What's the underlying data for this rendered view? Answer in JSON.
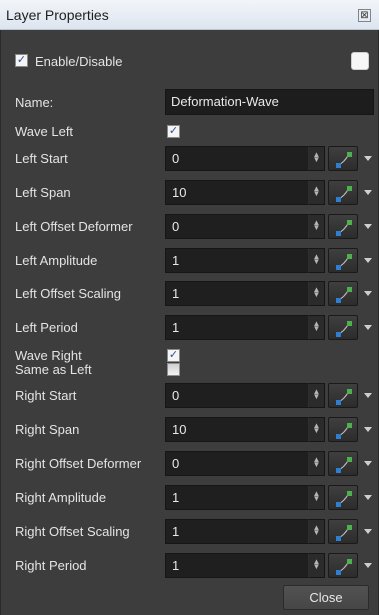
{
  "window": {
    "title": "Layer Properties",
    "close_glyph": "⊠"
  },
  "enable": {
    "label": "Enable/Disable",
    "checked": true
  },
  "name": {
    "label": "Name:",
    "value": "Deformation-Wave"
  },
  "close_button": {
    "label": "Close"
  },
  "rows": [
    {
      "type": "check",
      "label": "Wave Left",
      "checked": true
    },
    {
      "type": "field",
      "label": "Left Start",
      "value": "0"
    },
    {
      "type": "field",
      "label": "Left Span",
      "value": "10"
    },
    {
      "type": "field",
      "label": "Left Offset Deformer",
      "value": "0"
    },
    {
      "type": "field",
      "label": "Left Amplitude",
      "value": "1"
    },
    {
      "type": "field",
      "label": "Left Offset Scaling",
      "value": "1"
    },
    {
      "type": "field",
      "label": "Left Period",
      "value": "1"
    },
    {
      "type": "check",
      "label": "Wave Right",
      "checked": true
    },
    {
      "type": "check",
      "label": "Same as Left",
      "checked": false
    },
    {
      "type": "field",
      "label": "Right Start",
      "value": "0"
    },
    {
      "type": "field",
      "label": "Right Span",
      "value": "10"
    },
    {
      "type": "field",
      "label": "Right Offset Deformer",
      "value": "0"
    },
    {
      "type": "field",
      "label": "Right Amplitude",
      "value": "1"
    },
    {
      "type": "field",
      "label": "Right Offset Scaling",
      "value": "1"
    },
    {
      "type": "field",
      "label": "Right Period",
      "value": "1"
    }
  ],
  "icons": {
    "spin": "spin-arrows-icon",
    "function": "function-curve-icon",
    "menu": "dropdown-arrow-icon"
  },
  "colors": {
    "panel": "#3d3d3d",
    "field": "#1f1f1f",
    "accent_blue": "#2f7fd0",
    "accent_green": "#4fb04f"
  }
}
